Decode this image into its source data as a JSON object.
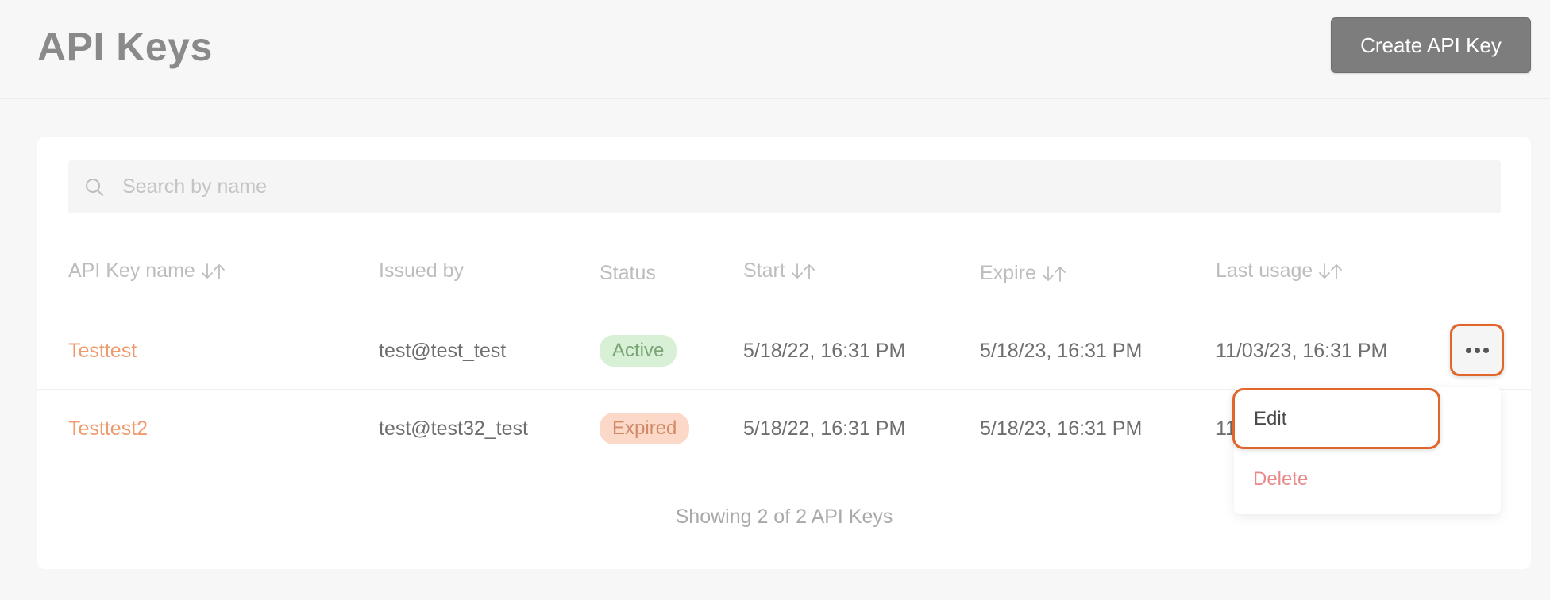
{
  "header": {
    "title": "API Keys",
    "create_label": "Create API Key"
  },
  "search": {
    "placeholder": "Search by name",
    "value": ""
  },
  "table": {
    "columns": [
      {
        "label": "API Key name",
        "sortable": true
      },
      {
        "label": "Issued by",
        "sortable": false
      },
      {
        "label": "Status",
        "sortable": false
      },
      {
        "label": "Start",
        "sortable": true
      },
      {
        "label": "Expire",
        "sortable": true
      },
      {
        "label": "Last usage",
        "sortable": true
      }
    ],
    "rows": [
      {
        "name": "Testtest",
        "issued_by": "test@test_test",
        "status": "Active",
        "start": "5/18/22, 16:31 PM",
        "expire": "5/18/23, 16:31 PM",
        "last_usage": "11/03/23, 16:31 PM"
      },
      {
        "name": "Testtest2",
        "issued_by": "test@test32_test",
        "status": "Expired",
        "start": "5/18/22, 16:31 PM",
        "expire": "5/18/23, 16:31 PM",
        "last_usage": "11"
      }
    ]
  },
  "footer": {
    "summary": "Showing 2 of 2 API Keys"
  },
  "menu": {
    "edit_label": "Edit",
    "delete_label": "Delete"
  },
  "icons": {
    "search": "search-icon",
    "sort": "sort-icon",
    "more": "more-horizontal-icon"
  },
  "colors": {
    "accent": "#ef9a6c",
    "highlight": "#e0662b",
    "active_badge": "#d8f0d6",
    "expired_badge": "#fbd8c7",
    "danger": "#e88a8a"
  }
}
